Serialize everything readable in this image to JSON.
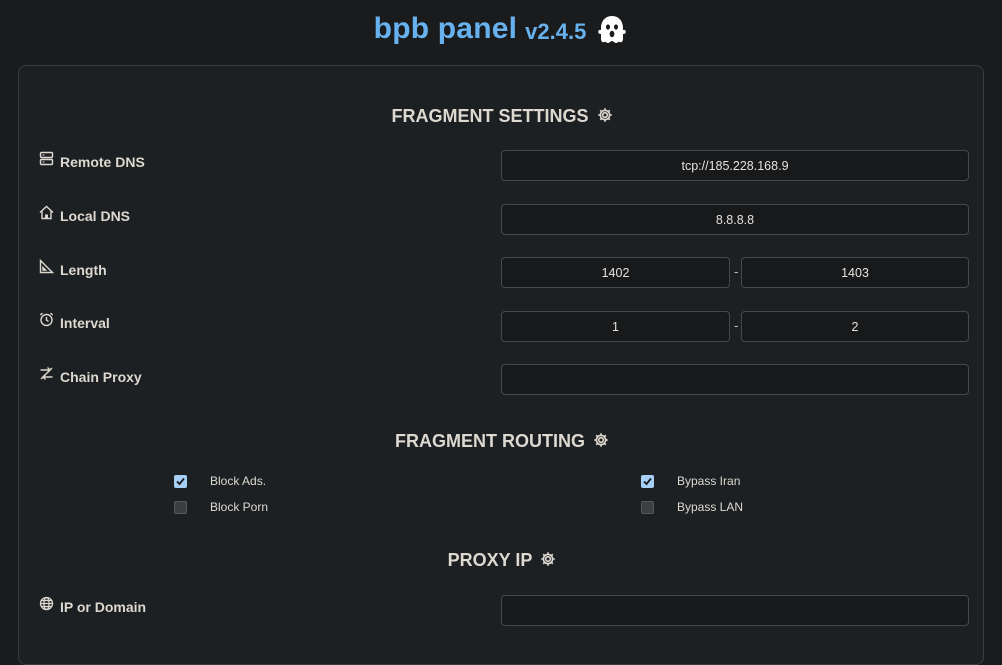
{
  "header": {
    "title": "bpb panel",
    "version": "v2.4.5",
    "ghost_icon": "ghost-icon",
    "accent_color": "#67b1ee"
  },
  "fragment_settings": {
    "heading": "FRAGMENT SETTINGS",
    "heading_icon": "gear-icon",
    "remote_dns": {
      "label": "Remote DNS",
      "icon": "server-icon",
      "value": "tcp://185.228.168.9"
    },
    "local_dns": {
      "label": "Local DNS",
      "icon": "home-icon",
      "value": "8.8.8.8"
    },
    "length": {
      "label": "Length",
      "icon": "ruler-triangle-icon",
      "min": "1402",
      "separator": "-",
      "max": "1403"
    },
    "interval": {
      "label": "Interval",
      "icon": "alarm-clock-icon",
      "min": "1",
      "separator": "-",
      "max": "2"
    },
    "chain_proxy": {
      "label": "Chain Proxy",
      "icon": "arrows-swap-icon",
      "value": ""
    }
  },
  "fragment_routing": {
    "heading": "FRAGMENT ROUTING",
    "heading_icon": "gear-icon",
    "options": [
      {
        "label": "Block Ads.",
        "checked": true
      },
      {
        "label": "Bypass Iran",
        "checked": true
      },
      {
        "label": "Block Porn",
        "checked": false
      },
      {
        "label": "Bypass LAN",
        "checked": false
      }
    ]
  },
  "proxy_ip": {
    "heading": "PROXY IP",
    "heading_icon": "gear-icon",
    "ip_or_domain": {
      "label": "IP or Domain",
      "icon": "globe-icon",
      "value": ""
    }
  }
}
